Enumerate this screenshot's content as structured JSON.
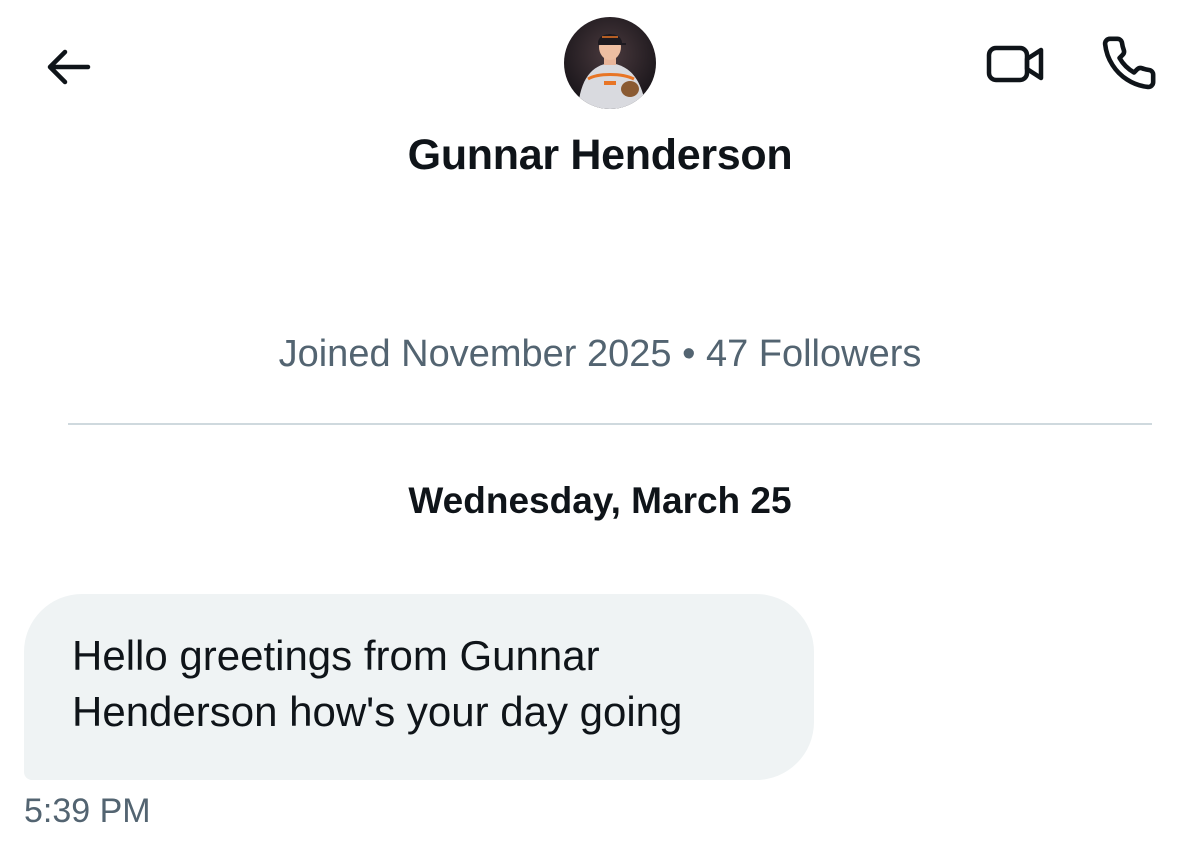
{
  "header": {
    "back_icon": "arrow-left-icon",
    "video_icon": "video-camera-icon",
    "call_icon": "phone-icon",
    "avatar_icon": "profile-photo"
  },
  "profile": {
    "display_name": "Gunnar Henderson",
    "meta": "Joined November 2025 • 47 Followers"
  },
  "conversation": {
    "date_separator": "Wednesday, March 25",
    "messages": [
      {
        "text": "Hello greetings from Gunnar Henderson how's your day going",
        "time": "5:39 PM"
      }
    ]
  },
  "colors": {
    "text_primary": "#0f1419",
    "text_secondary": "#536471",
    "bubble_bg": "#eff3f4",
    "divider": "#cfd9de"
  }
}
